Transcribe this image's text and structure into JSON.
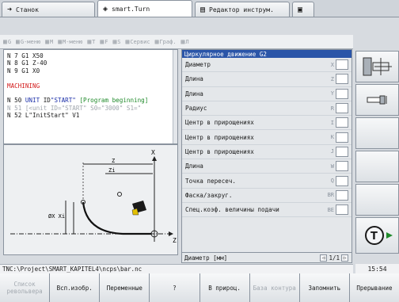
{
  "tabs": [
    {
      "label": "Станок",
      "icon": "arrow-right-icon"
    },
    {
      "label": "smart.Turn",
      "icon": "diamond-arrows-icon"
    },
    {
      "label": "Редактор инструм.",
      "icon": "document-edit-icon"
    },
    {
      "label": "",
      "icon": "floppy-icon"
    }
  ],
  "menu": [
    "G",
    "G-меню",
    "M",
    "M-меню",
    "T",
    "F",
    "S",
    "Сервис",
    "Граф.",
    "Л"
  ],
  "listing": {
    "lines": [
      {
        "text": "N   7 G1 X50",
        "cls": ""
      },
      {
        "text": "N   8 G1 Z-40",
        "cls": ""
      },
      {
        "text": "N   9 G1 X0",
        "cls": ""
      },
      {
        "text": "",
        "cls": ""
      },
      {
        "text": "MACHINING",
        "cls": "red"
      },
      {
        "text": "",
        "cls": ""
      },
      {
        "text": "N  50 UNIT ID\"START\" [Program beginning]",
        "cls": "mix"
      },
      {
        "text": "N  51   [<unit ID=\"START\" S0=\"3000\" S1=\"",
        "cls": "gray"
      },
      {
        "text": "N  52   L\"InitStart\" V1",
        "cls": ""
      }
    ]
  },
  "drawing": {
    "axis_x": "X",
    "axis_z": "Z",
    "dim_z": "Z",
    "dim_zi": "Zi",
    "dim_x": "ØX Xi"
  },
  "form": {
    "title": "Циркулярное движение G2",
    "rows": [
      {
        "label": "Диаметр",
        "key": "X"
      },
      {
        "label": "Длина",
        "key": "Z"
      },
      {
        "label": "Длина",
        "key": "Y"
      },
      {
        "label": "Радиус",
        "key": "R"
      },
      {
        "label": "Центр в прирощениях",
        "key": "I"
      },
      {
        "label": "Центр в прирощениях",
        "key": "K"
      },
      {
        "label": "Центр в прирощениях",
        "key": "J"
      },
      {
        "label": "Длина",
        "key": "W"
      },
      {
        "label": "Точка пересеч.",
        "key": "Q"
      },
      {
        "label": "Фаска/закруг.",
        "key": "BR"
      },
      {
        "label": "Спец.коэф. величины подачи",
        "key": "BE"
      }
    ],
    "footer_label": "Диаметр [мм]",
    "page": "1/1"
  },
  "status": {
    "path": "TNC:\\Project\\SMART_KAPITEL4\\ncps\\bar.nc",
    "time": "15:54"
  },
  "softkeys": [
    {
      "label": "Список револьвера",
      "disabled": true
    },
    {
      "label": "Всп.изобр.",
      "disabled": false
    },
    {
      "label": "Переменные",
      "disabled": false
    },
    {
      "label": "?",
      "disabled": false
    },
    {
      "label": "В прироц.",
      "disabled": false
    },
    {
      "label": "База контура",
      "disabled": true
    },
    {
      "label": "Запомнить",
      "disabled": false
    },
    {
      "label": "Прерывание",
      "disabled": false
    }
  ],
  "colors": {
    "accent": "#2a55a8",
    "red": "#d21a1a",
    "green": "#1f8a2a",
    "blue": "#1a2ea8"
  }
}
